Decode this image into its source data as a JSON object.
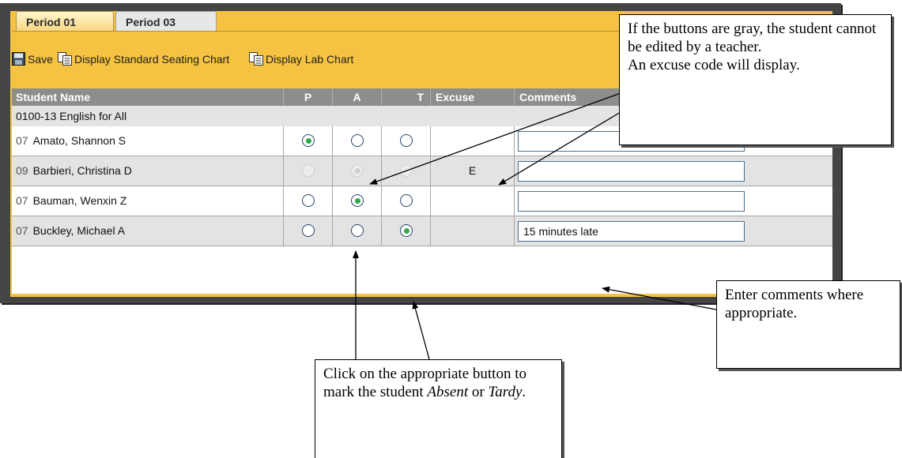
{
  "tabs": [
    {
      "label": "Period 01",
      "active": true
    },
    {
      "label": "Period 03",
      "active": false
    }
  ],
  "toolbar": {
    "save_label": "Save",
    "standard_chart_label": "Display Standard Seating Chart",
    "lab_chart_label": "Display Lab Chart"
  },
  "table": {
    "headers": {
      "student_name": "Student Name",
      "p": "P",
      "a": "A",
      "t": "T",
      "excuse": "Excuse",
      "comments": "Comments"
    },
    "course": "0100-13 English for All",
    "rows": [
      {
        "grade": "07",
        "name": "Amato, Shannon S",
        "status": "P",
        "disabled": false,
        "excuse": "",
        "comment": ""
      },
      {
        "grade": "09",
        "name": "Barbieri, Christina D",
        "status": "A",
        "disabled": true,
        "excuse": "E",
        "comment": ""
      },
      {
        "grade": "07",
        "name": "Bauman, Wenxin Z",
        "status": "A",
        "disabled": false,
        "excuse": "",
        "comment": ""
      },
      {
        "grade": "07",
        "name": "Buckley, Michael A",
        "status": "T",
        "disabled": false,
        "excuse": "",
        "comment": "15 minutes late"
      }
    ]
  },
  "callouts": {
    "gray_buttons": "If the buttons are gray, the student cannot be edited by a teacher.",
    "excuse_code": "An excuse code will display.",
    "enter_comments": "Enter comments where appropriate.",
    "click_prefix": "Click on the appropriate button to mark the student ",
    "click_absent": "Absent",
    "click_or": " or ",
    "click_tardy": "Tardy",
    "click_suffix": "."
  },
  "colors": {
    "tab_bar": "#f5c341",
    "header_bg": "#8d8d8d",
    "checked_radio": "#2fa94e"
  }
}
